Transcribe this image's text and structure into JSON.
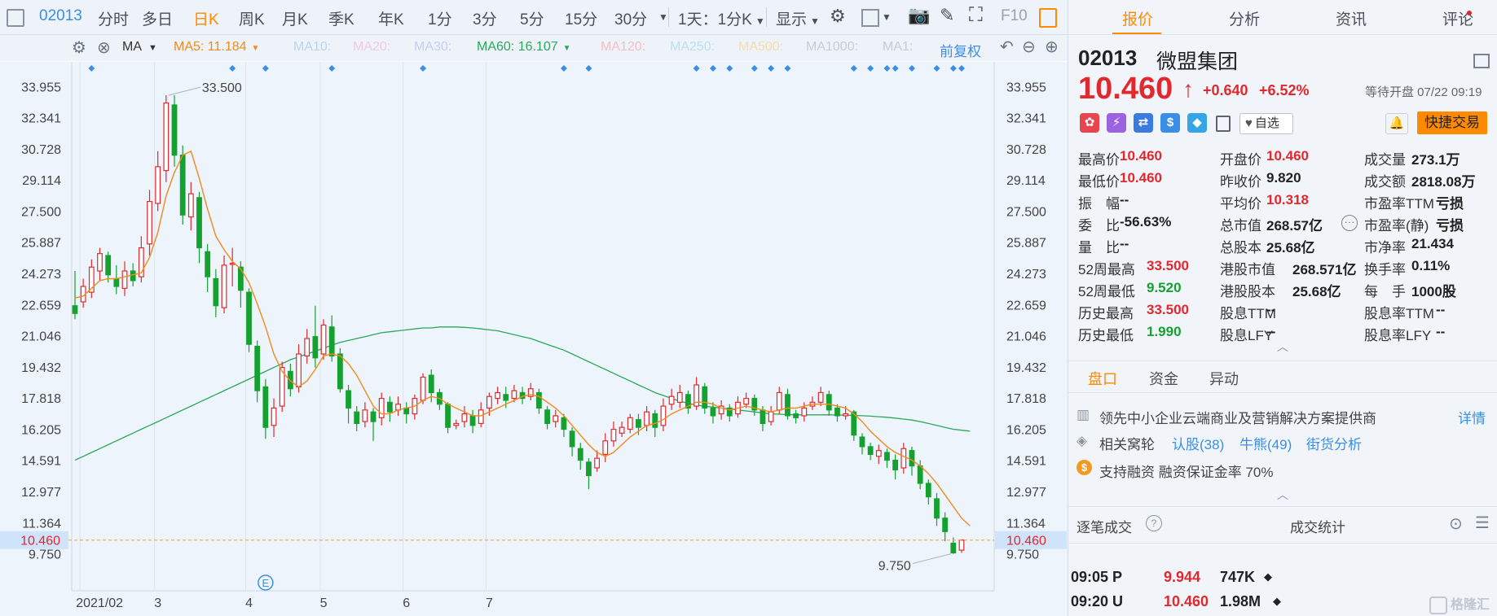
{
  "toolbar": {
    "code": "02013",
    "items": [
      "分时",
      "多日",
      "日K",
      "周K",
      "月K",
      "季K",
      "年K",
      "1分",
      "3分",
      "5分",
      "15分",
      "30分"
    ],
    "active": "日K",
    "period_select": "1天：1分K",
    "display": "显示",
    "f10": "F10"
  },
  "ma_row": {
    "ma_label": "MA",
    "ma5": "MA5: 11.184",
    "ma10": "MA10:",
    "ma20": "MA20:",
    "ma30": "MA30:",
    "ma60": "MA60: 16.107",
    "ma120": "MA120:",
    "ma250": "MA250:",
    "ma500": "MA500:",
    "ma1000": "MA1000:",
    "ma1": "MA1:",
    "adjust": "前复权"
  },
  "chart_data": {
    "type": "candlestick",
    "title": "",
    "ylim": [
      9.1,
      34.6
    ],
    "yticks": [
      "33.955",
      "32.341",
      "30.728",
      "29.114",
      "27.500",
      "25.887",
      "24.273",
      "22.659",
      "21.046",
      "19.432",
      "17.818",
      "16.205",
      "14.591",
      "12.977",
      "11.364",
      "9.750"
    ],
    "ytick_values": [
      33.955,
      32.341,
      30.728,
      29.114,
      27.5,
      25.887,
      24.273,
      22.659,
      21.046,
      19.432,
      17.818,
      16.205,
      14.591,
      12.977,
      11.364,
      9.75
    ],
    "xlabels": [
      "2021/02",
      "3",
      "4",
      "5",
      "6",
      "7"
    ],
    "xlabel_index": [
      1,
      10,
      21,
      30,
      40,
      50
    ],
    "high_label": "33.500",
    "low_label": "9.750",
    "current_price": "10.460",
    "current_value": 10.46,
    "candles": [
      [
        22.6,
        22.2,
        24.4,
        21.9
      ],
      [
        22.8,
        23.6,
        24.0,
        22.5
      ],
      [
        23.3,
        24.6,
        25.0,
        23.0
      ],
      [
        24.4,
        25.3,
        25.6,
        23.9
      ],
      [
        25.2,
        24.2,
        25.4,
        23.8
      ],
      [
        24.0,
        23.6,
        24.7,
        23.2
      ],
      [
        23.5,
        24.4,
        24.9,
        23.1
      ],
      [
        24.4,
        23.9,
        24.8,
        23.6
      ],
      [
        24.1,
        25.6,
        26.2,
        23.8
      ],
      [
        25.8,
        28.0,
        28.6,
        25.2
      ],
      [
        27.9,
        29.8,
        30.6,
        27.5
      ],
      [
        29.6,
        33.1,
        33.5,
        29.0
      ],
      [
        33.0,
        30.4,
        33.5,
        29.8
      ],
      [
        30.4,
        27.3,
        30.9,
        26.8
      ],
      [
        27.2,
        28.4,
        29.0,
        26.5
      ],
      [
        28.2,
        25.6,
        28.5,
        24.8
      ],
      [
        25.4,
        24.1,
        25.8,
        23.3
      ],
      [
        24.0,
        22.6,
        24.5,
        22.0
      ],
      [
        22.5,
        24.7,
        25.2,
        22.2
      ],
      [
        24.8,
        24.8,
        25.6,
        23.6
      ],
      [
        24.6,
        23.4,
        24.9,
        22.5
      ],
      [
        23.3,
        20.6,
        23.5,
        20.2
      ],
      [
        20.5,
        18.2,
        20.8,
        17.6
      ],
      [
        18.4,
        16.3,
        18.8,
        15.7
      ],
      [
        16.4,
        17.3,
        17.8,
        15.8
      ],
      [
        17.4,
        19.4,
        19.7,
        17.1
      ],
      [
        19.2,
        18.3,
        19.6,
        17.9
      ],
      [
        18.4,
        20.1,
        20.6,
        18.1
      ],
      [
        20.0,
        20.9,
        21.4,
        19.6
      ],
      [
        21.0,
        19.9,
        22.6,
        19.4
      ],
      [
        20.1,
        21.6,
        21.9,
        19.8
      ],
      [
        21.5,
        20.0,
        22.1,
        19.7
      ],
      [
        20.1,
        18.3,
        20.4,
        18.1
      ],
      [
        18.2,
        17.3,
        18.5,
        16.5
      ],
      [
        17.1,
        16.5,
        17.4,
        16.1
      ],
      [
        16.6,
        17.2,
        17.6,
        16.3
      ],
      [
        17.1,
        16.6,
        17.3,
        15.6
      ],
      [
        16.8,
        17.8,
        18.1,
        16.4
      ],
      [
        17.6,
        17.1,
        17.9,
        16.6
      ],
      [
        17.2,
        17.5,
        17.9,
        16.9
      ],
      [
        17.3,
        17.0,
        17.6,
        16.5
      ],
      [
        17.0,
        17.8,
        18.0,
        16.7
      ],
      [
        17.7,
        18.9,
        19.1,
        17.5
      ],
      [
        19.0,
        18.1,
        19.3,
        17.6
      ],
      [
        18.1,
        17.5,
        18.3,
        17.2
      ],
      [
        17.5,
        16.3,
        17.6,
        16.0
      ],
      [
        16.4,
        16.5,
        16.7,
        16.2
      ],
      [
        16.6,
        17.0,
        17.4,
        16.3
      ],
      [
        16.9,
        16.4,
        17.2,
        16.0
      ],
      [
        16.5,
        17.2,
        17.6,
        16.3
      ],
      [
        17.3,
        17.9,
        18.1,
        16.9
      ],
      [
        17.8,
        18.1,
        18.4,
        17.5
      ],
      [
        18.0,
        17.7,
        18.4,
        17.3
      ],
      [
        17.8,
        18.2,
        18.5,
        17.6
      ],
      [
        18.1,
        17.8,
        18.4,
        17.5
      ],
      [
        17.9,
        18.3,
        18.6,
        17.7
      ],
      [
        18.1,
        17.3,
        18.3,
        17.0
      ],
      [
        17.2,
        16.5,
        17.4,
        16.2
      ],
      [
        16.6,
        16.9,
        17.2,
        16.3
      ],
      [
        16.8,
        16.2,
        17.0,
        15.8
      ],
      [
        16.1,
        15.3,
        16.3,
        14.8
      ],
      [
        15.2,
        14.6,
        15.5,
        14.1
      ],
      [
        14.5,
        13.8,
        14.7,
        13.1
      ],
      [
        14.2,
        14.7,
        15.1,
        14.0
      ],
      [
        14.9,
        15.6,
        16.0,
        14.5
      ],
      [
        15.6,
        16.2,
        16.6,
        15.3
      ],
      [
        16.0,
        16.3,
        16.6,
        15.8
      ],
      [
        16.2,
        16.8,
        17.0,
        16.0
      ],
      [
        16.7,
        16.3,
        17.0,
        15.9
      ],
      [
        16.4,
        17.1,
        17.4,
        16.1
      ],
      [
        17.0,
        16.3,
        17.2,
        15.8
      ],
      [
        16.4,
        17.4,
        17.8,
        16.1
      ],
      [
        17.5,
        17.9,
        18.3,
        17.2
      ],
      [
        17.6,
        18.1,
        18.5,
        17.3
      ],
      [
        18.0,
        17.3,
        18.2,
        17.0
      ],
      [
        17.4,
        18.5,
        18.9,
        17.2
      ],
      [
        18.4,
        17.3,
        18.6,
        17.0
      ],
      [
        17.3,
        16.9,
        17.6,
        16.5
      ],
      [
        17.0,
        17.4,
        17.7,
        16.7
      ],
      [
        17.3,
        16.9,
        17.5,
        16.6
      ],
      [
        17.0,
        17.6,
        17.9,
        16.8
      ],
      [
        17.5,
        17.8,
        18.1,
        17.3
      ],
      [
        17.8,
        17.2,
        18.0,
        16.9
      ],
      [
        17.2,
        16.5,
        17.4,
        16.1
      ],
      [
        16.6,
        17.1,
        17.4,
        16.4
      ],
      [
        17.2,
        18.1,
        18.4,
        17.0
      ],
      [
        18.0,
        16.9,
        18.3,
        16.7
      ],
      [
        17.0,
        16.8,
        17.2,
        16.5
      ],
      [
        16.9,
        17.3,
        17.6,
        16.6
      ],
      [
        17.4,
        17.6,
        17.9,
        17.2
      ],
      [
        17.6,
        18.1,
        18.4,
        17.4
      ],
      [
        18.0,
        17.2,
        18.2,
        16.9
      ],
      [
        17.3,
        16.9,
        17.5,
        16.6
      ],
      [
        16.9,
        17.0,
        17.4,
        16.7
      ],
      [
        17.1,
        15.9,
        17.2,
        15.6
      ],
      [
        15.8,
        15.3,
        16.0,
        14.9
      ],
      [
        15.3,
        14.9,
        15.5,
        14.6
      ],
      [
        14.8,
        15.1,
        15.4,
        14.4
      ],
      [
        15.0,
        14.6,
        15.2,
        14.2
      ],
      [
        14.6,
        14.1,
        14.9,
        13.6
      ],
      [
        14.2,
        15.2,
        15.5,
        13.9
      ],
      [
        15.1,
        14.3,
        15.3,
        13.8
      ],
      [
        14.3,
        13.4,
        14.6,
        13.1
      ],
      [
        13.4,
        12.7,
        13.6,
        12.3
      ],
      [
        12.6,
        11.6,
        12.9,
        11.2
      ],
      [
        11.6,
        10.9,
        11.9,
        10.4
      ],
      [
        10.3,
        9.8,
        10.6,
        9.75
      ],
      [
        9.94,
        10.46,
        10.5,
        9.8
      ]
    ],
    "ma5_line": [
      23.0,
      23.1,
      23.5,
      23.9,
      24.0,
      24.0,
      24.1,
      24.2,
      24.3,
      25.1,
      26.4,
      28.3,
      29.5,
      30.4,
      30.6,
      29.2,
      27.6,
      26.2,
      25.5,
      24.9,
      24.5,
      23.8,
      22.7,
      21.5,
      20.1,
      19.2,
      18.7,
      18.4,
      18.7,
      19.3,
      20.0,
      20.1,
      20.0,
      19.6,
      19.0,
      18.2,
      17.4,
      17.0,
      17.0,
      17.2,
      17.3,
      17.4,
      17.7,
      17.9,
      17.8,
      17.5,
      17.3,
      17.1,
      16.9,
      16.9,
      17.1,
      17.3,
      17.5,
      17.7,
      17.9,
      18.0,
      17.9,
      17.6,
      17.3,
      16.9,
      16.4,
      15.9,
      15.4,
      15.0,
      14.8,
      15.0,
      15.4,
      15.8,
      16.1,
      16.4,
      16.5,
      16.7,
      17.0,
      17.2,
      17.4,
      17.6,
      17.6,
      17.5,
      17.3,
      17.2,
      17.3,
      17.4,
      17.3,
      17.2,
      17.1,
      17.2,
      17.3,
      17.3,
      17.4,
      17.5,
      17.5,
      17.5,
      17.4,
      17.3,
      17.0,
      16.6,
      16.1,
      15.7,
      15.3,
      15.0,
      14.8,
      14.6,
      14.3,
      13.9,
      13.4,
      12.8,
      12.2,
      11.6,
      11.2
    ],
    "ma60_line": [
      14.6,
      14.8,
      15.0,
      15.2,
      15.4,
      15.6,
      15.8,
      16.0,
      16.2,
      16.4,
      16.6,
      16.8,
      17.0,
      17.2,
      17.4,
      17.6,
      17.8,
      18.0,
      18.2,
      18.4,
      18.6,
      18.8,
      19.0,
      19.2,
      19.4,
      19.6,
      19.8,
      19.95,
      20.1,
      20.25,
      20.4,
      20.55,
      20.7,
      20.8,
      20.9,
      21.0,
      21.1,
      21.2,
      21.25,
      21.3,
      21.35,
      21.4,
      21.45,
      21.45,
      21.5,
      21.5,
      21.5,
      21.48,
      21.45,
      21.4,
      21.35,
      21.3,
      21.2,
      21.1,
      21.0,
      20.9,
      20.75,
      20.6,
      20.45,
      20.3,
      20.1,
      19.9,
      19.7,
      19.5,
      19.3,
      19.1,
      18.9,
      18.7,
      18.5,
      18.3,
      18.1,
      17.95,
      17.8,
      17.65,
      17.55,
      17.45,
      17.4,
      17.35,
      17.3,
      17.25,
      17.2,
      17.15,
      17.1,
      17.05,
      17.0,
      16.98,
      16.96,
      16.95,
      16.95,
      16.95,
      16.95,
      16.95,
      16.94,
      16.93,
      16.92,
      16.9,
      16.88,
      16.85,
      16.82,
      16.78,
      16.73,
      16.68,
      16.6,
      16.5,
      16.4,
      16.3,
      16.2,
      16.15,
      16.107
    ],
    "markers_index": [
      2,
      19,
      23,
      31,
      42,
      59,
      62,
      75,
      77,
      79,
      82,
      84,
      86,
      94,
      96,
      98,
      99,
      101,
      104,
      106,
      107
    ]
  },
  "right": {
    "tabs": [
      "报价",
      "分析",
      "资讯",
      "评论"
    ],
    "active_tab": "报价",
    "code": "02013",
    "name": "微盟集团",
    "price": "10.460",
    "change": "+0.640",
    "pct": "+6.52%",
    "status": "等待开盘 07/22 09:19",
    "watch": "自选",
    "trade": "快捷交易",
    "stats": {
      "c1": [
        [
          "最高价",
          "10.460",
          "red"
        ],
        [
          "最低价",
          "10.460",
          "red"
        ],
        [
          "振　幅",
          "--",
          "dark"
        ],
        [
          "委　比",
          "-56.63%",
          "dark"
        ],
        [
          "量　比",
          "--",
          "dark"
        ],
        [
          "52周最高",
          "33.500",
          "red"
        ],
        [
          "52周最低",
          "9.520",
          "green"
        ],
        [
          "历史最高",
          "33.500",
          "red"
        ],
        [
          "历史最低",
          "1.990",
          "green"
        ]
      ],
      "c2": [
        [
          "开盘价",
          "10.460",
          "red"
        ],
        [
          "昨收价",
          "9.820",
          "dark"
        ],
        [
          "平均价",
          "10.318",
          "red"
        ],
        [
          "总市值",
          "268.57亿",
          "dark"
        ],
        [
          "总股本",
          "25.68亿",
          "dark"
        ],
        [
          "港股市值",
          "268.571亿",
          "dark"
        ],
        [
          "港股股本",
          "25.68亿",
          "dark"
        ],
        [
          "股息TTM",
          "--",
          "dark"
        ],
        [
          "股息LFY",
          "--",
          "dark"
        ]
      ],
      "c3": [
        [
          "成交量",
          "273.1万",
          "dark"
        ],
        [
          "成交额",
          "2818.08万",
          "dark"
        ],
        [
          "市盈率TTM",
          "亏损",
          "dark"
        ],
        [
          "市盈率(静)",
          "亏损",
          "dark"
        ],
        [
          "市净率",
          "21.434",
          "dark"
        ],
        [
          "换手率",
          "0.11%",
          "dark"
        ],
        [
          "每　手",
          "1000股",
          "dark"
        ],
        [
          "股息率TTM",
          "--",
          "dark"
        ],
        [
          "股息率LFY",
          "--",
          "dark"
        ]
      ]
    },
    "subtabs": [
      "盘口",
      "资金",
      "异动"
    ],
    "active_subtab": "盘口",
    "desc": "领先中小企业云端商业及营销解决方案提供商",
    "detail": "详情",
    "related_label": "相关窝轮",
    "warrants": "认股(38)",
    "bulls": "牛熊(49)",
    "street": "街货分析",
    "margin": "支持融资  融资保证金率 70%",
    "trades_title": "逐笔成交",
    "trades_stats": "成交统计",
    "trades": [
      {
        "time": "09:05 P",
        "price": "9.944",
        "vol": "747K",
        "color": "red"
      },
      {
        "time": "09:20 U",
        "price": "10.460",
        "vol": "1.98M",
        "color": "red"
      }
    ],
    "watermark": "格隆汇"
  }
}
